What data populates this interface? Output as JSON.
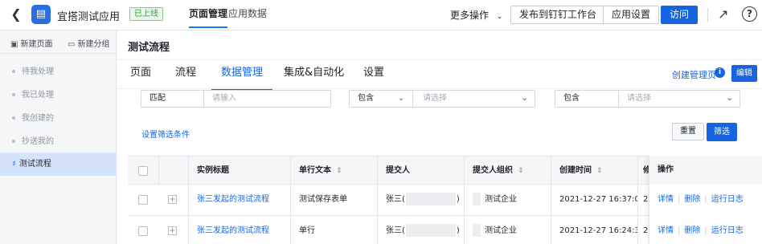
{
  "topbar": {
    "back_icon": "chevron-left-icon",
    "app_icon": "app-icon",
    "app_name": "宜搭测试应用",
    "status": "已上线",
    "tabs": [
      {
        "label": "页面管理",
        "active": true
      },
      {
        "label": "应用数据",
        "active": false
      }
    ],
    "more_actions": "更多操作",
    "publish_label": "发布到钉钉工作台",
    "settings_label": "应用设置",
    "visit_label": "访问",
    "external_icon": "external-link-icon",
    "help_icon": "help-icon"
  },
  "sidebar": {
    "new_page": "新建页面",
    "new_group": "新建分组",
    "items": [
      {
        "label": "待我处理",
        "active": false
      },
      {
        "label": "我已处理",
        "active": false
      },
      {
        "label": "我创建的",
        "active": false
      },
      {
        "label": "抄送我的",
        "active": false
      },
      {
        "label": "测试流程",
        "active": true
      }
    ]
  },
  "main": {
    "title": "测试流程",
    "tabs": [
      {
        "label": "页面",
        "active": false
      },
      {
        "label": "流程",
        "active": false
      },
      {
        "label": "数据管理",
        "active": true
      },
      {
        "label": "集成&自动化",
        "active": false
      },
      {
        "label": "设置",
        "active": false
      }
    ],
    "create_manage_page": "创建管理页",
    "edit_label": "编辑"
  },
  "filters": {
    "items": [
      {
        "operator": "匹配",
        "placeholder": "请输入",
        "operator_dropdown": false
      },
      {
        "operator": "包含",
        "placeholder": "请选择",
        "operator_dropdown": true
      },
      {
        "operator": "包含",
        "placeholder": "请选择",
        "operator_dropdown": false
      }
    ],
    "advanced_link": "设置筛选条件",
    "reset_label": "重置",
    "filter_label": "筛选"
  },
  "table": {
    "headers": [
      "实例标题",
      "单行文本",
      "提交人",
      "提交人组织",
      "创建时间",
      "修",
      "操作"
    ],
    "rows": [
      {
        "title": "张三发起的测试流程",
        "text": "测试保存表单",
        "submitter_prefix": "张三(",
        "submitter_suffix": ")",
        "org": "测试企业",
        "created": "2021-12-27 16:37:03",
        "extra": "2"
      },
      {
        "title": "张三发起的测试流程",
        "text": "单行",
        "submitter_prefix": "张三(",
        "submitter_suffix": ")",
        "org": "测试企业",
        "created": "2021-12-27 16:24:32",
        "extra": "2"
      }
    ],
    "actions": [
      "详情",
      "删除",
      "运行日志"
    ]
  },
  "colors": {
    "primary": "#1664e0",
    "status_green": "#2ca43a",
    "sidebar_active": "#d6e4fb"
  }
}
